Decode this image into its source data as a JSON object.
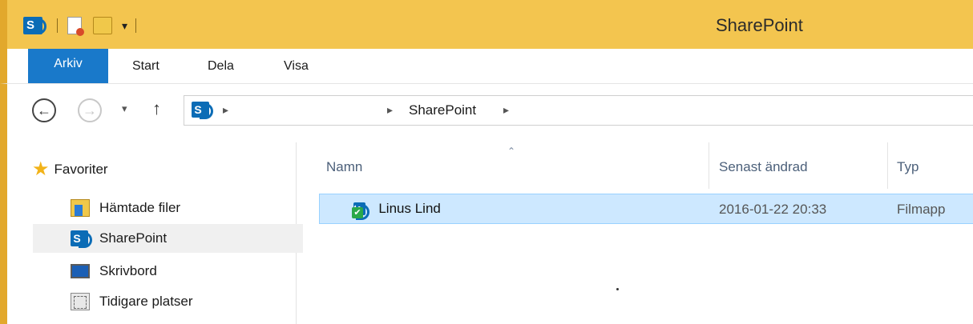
{
  "window": {
    "title": "SharePoint"
  },
  "quick_access": {
    "dropdown_glyph": "▾"
  },
  "ribbon": {
    "tabs": [
      "Arkiv",
      "Start",
      "Dela",
      "Visa"
    ]
  },
  "address": {
    "path_segment": "SharePoint",
    "sep": "▸"
  },
  "nav": {
    "favorites_label": "Favoriter",
    "items": [
      {
        "label": "Hämtade filer",
        "icon": "downloads-folder-icon"
      },
      {
        "label": "SharePoint",
        "icon": "sharepoint-icon"
      },
      {
        "label": "Skrivbord",
        "icon": "desktop-icon"
      },
      {
        "label": "Tidigare platser",
        "icon": "recent-places-icon"
      }
    ]
  },
  "list": {
    "columns": [
      "Namn",
      "Senast ändrad",
      "Typ"
    ],
    "rows": [
      {
        "name": "Linus Lind",
        "modified": "2016-01-22 20:33",
        "type": "Filmapp"
      }
    ]
  },
  "glyphs": {
    "back": "←",
    "forward": "→",
    "recent": "▾",
    "up": "↑",
    "star": "★",
    "check": "✔",
    "sort": "⌃"
  },
  "colors": {
    "titlebar": "#f3c54f",
    "arkiv_tab": "#1979ca",
    "selection": "#cde8ff",
    "sharepoint": "#0b6cb6"
  }
}
